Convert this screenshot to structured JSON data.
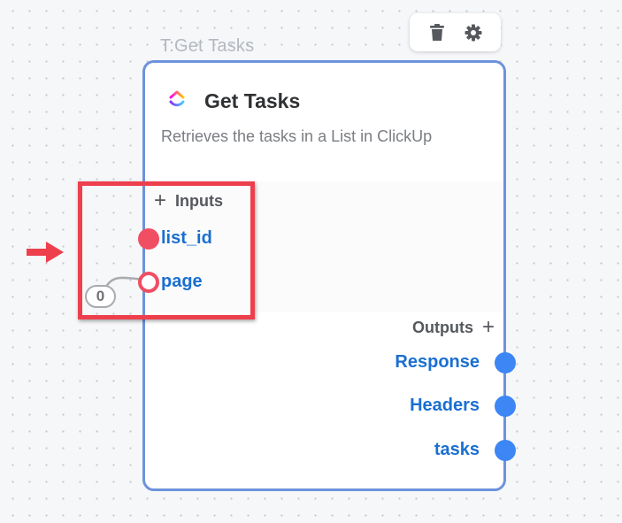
{
  "toolbar": {
    "delete_icon": "trash-icon",
    "settings_icon": "gear-icon"
  },
  "node": {
    "label": "T:Get Tasks",
    "title": "Get Tasks",
    "description": "Retrieves the tasks in a List in ClickUp",
    "logo_icon": "clickup-logo",
    "inputs_header": "Inputs",
    "outputs_header": "Outputs",
    "inputs": [
      {
        "name": "list_id",
        "connected": true
      },
      {
        "name": "page",
        "connected": false,
        "default_value": "0"
      }
    ],
    "outputs": [
      {
        "name": "Response"
      },
      {
        "name": "Headers"
      },
      {
        "name": "tasks"
      }
    ]
  },
  "colors": {
    "node_border": "#6c93dc",
    "input_port": "#ef4e63",
    "output_port": "#3d86f5",
    "port_label": "#1a6fd0",
    "highlight": "#ee3f4d"
  }
}
